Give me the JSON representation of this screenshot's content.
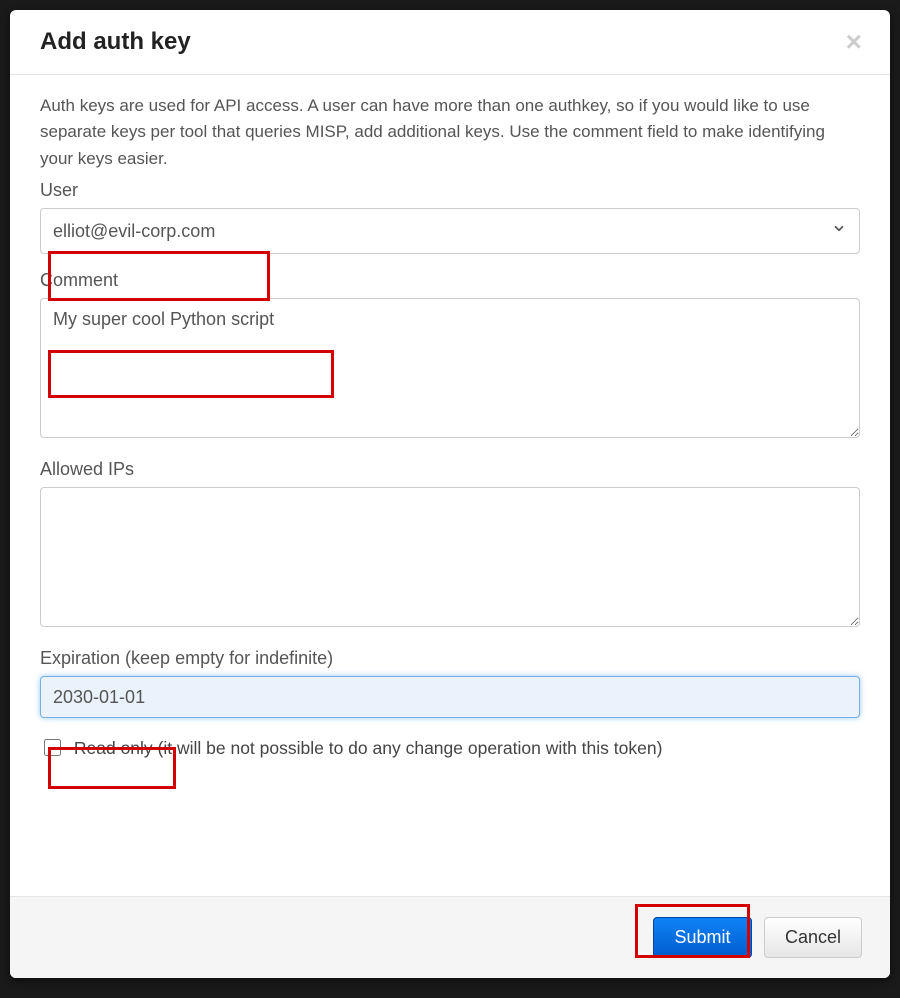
{
  "modal": {
    "title": "Add auth key",
    "close_glyph": "×"
  },
  "description": "Auth keys are used for API access. A user can have more than one authkey, so if you would like to use separate keys per tool that queries MISP, add additional keys. Use the comment field to make identifying your keys easier.",
  "labels": {
    "user": "User",
    "comment": "Comment",
    "allowed_ips": "Allowed IPs",
    "expiration": "Expiration (keep empty for indefinite)",
    "read_only": "Read only (it will be not possible to do any change operation with this token)"
  },
  "values": {
    "user": "elliot@evil-corp.com",
    "comment": "My super cool Python script",
    "allowed_ips": "",
    "expiration": "2030-01-01",
    "read_only_checked": false
  },
  "buttons": {
    "submit": "Submit",
    "cancel": "Cancel"
  }
}
